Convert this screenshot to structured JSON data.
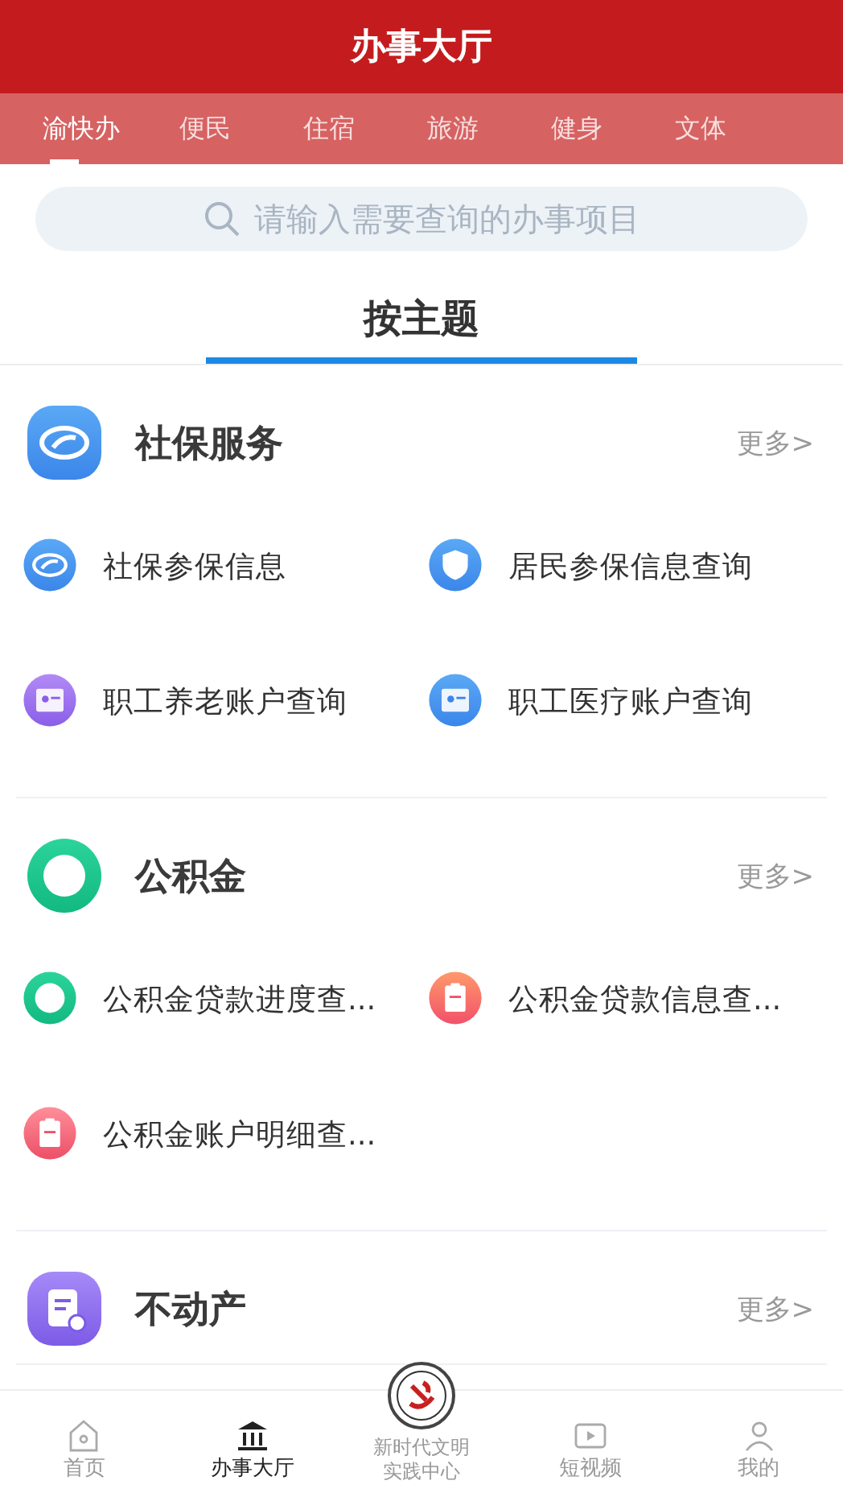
{
  "header": {
    "title": "办事大厅"
  },
  "tabs": [
    {
      "label": "渝快办",
      "selected": true
    },
    {
      "label": "便民",
      "selected": false
    },
    {
      "label": "住宿",
      "selected": false
    },
    {
      "label": "旅游",
      "selected": false
    },
    {
      "label": "健身",
      "selected": false
    },
    {
      "label": "文体",
      "selected": false
    }
  ],
  "search": {
    "placeholder": "请输入需要查询的办事项目"
  },
  "subtabs": [
    {
      "label": "按主题",
      "selected": true
    }
  ],
  "sections": [
    {
      "title": "社保服务",
      "more": "更多>",
      "items": [
        {
          "label": "社保参保信息"
        },
        {
          "label": "居民参保信息查询"
        },
        {
          "label": "职工养老账户查询"
        },
        {
          "label": "职工医疗账户查询"
        }
      ]
    },
    {
      "title": "公积金",
      "more": "更多>",
      "items": [
        {
          "label": "公积金贷款进度查..."
        },
        {
          "label": "公积金贷款信息查..."
        },
        {
          "label": "公积金账户明细查..."
        }
      ]
    },
    {
      "title": "不动产",
      "more": "更多>"
    }
  ],
  "bottom_nav": [
    {
      "label": "首页",
      "selected": false
    },
    {
      "label": "办事大厅",
      "selected": true
    },
    {
      "label": "新时代文明实践中心",
      "selected": false
    },
    {
      "label": "短视频",
      "selected": false
    },
    {
      "label": "我的",
      "selected": false
    }
  ]
}
